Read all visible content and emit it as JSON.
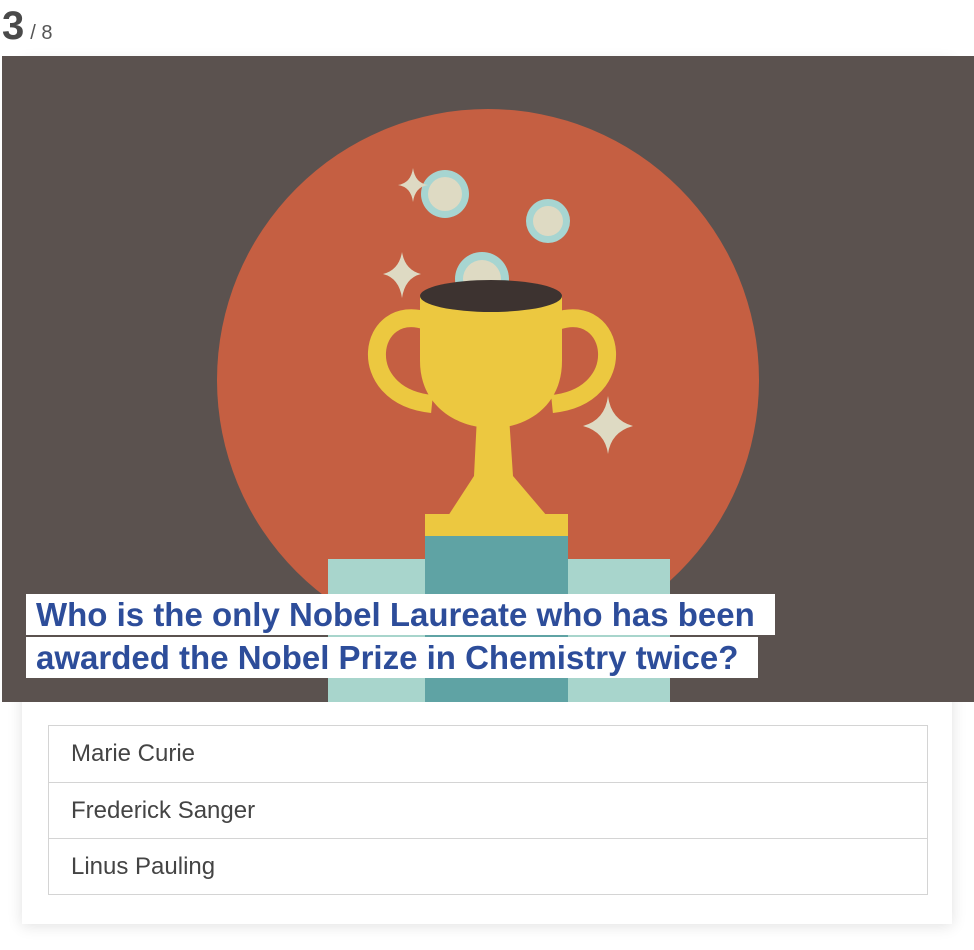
{
  "progress": {
    "current": "3",
    "total": "/ 8"
  },
  "question": {
    "text": "Who is the only Nobel Laureate who has been awarded the Nobel Prize in Chemistry twice?",
    "image": {
      "icon": "trophy-illustration",
      "colors": {
        "background": "#5b524f",
        "circle": "#c55f42",
        "trophy": "#ecc840",
        "coin": "#dedac3",
        "coin_ring": "#a7d5d1",
        "podium_light": "#a8d5cc",
        "podium_dark": "#5fa3a4"
      }
    }
  },
  "answers": [
    {
      "label": "Marie Curie"
    },
    {
      "label": "Frederick Sanger"
    },
    {
      "label": "Linus Pauling"
    }
  ]
}
